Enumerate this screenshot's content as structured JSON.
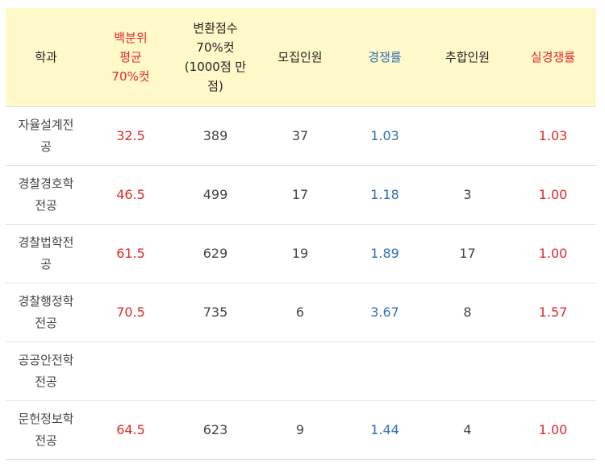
{
  "header": {
    "dept": "학과",
    "percentile": [
      "백분위",
      "평균",
      "70%컷"
    ],
    "converted": [
      "변환점수",
      "70%컷",
      "(1000점 만",
      "점)"
    ],
    "recruit": "모집인원",
    "competition": "경쟁률",
    "additional": "추합인원",
    "real_competition": "실경쟁률"
  },
  "colors": {
    "red": "#e02a2a",
    "blue": "#2f6fb8",
    "header_bg": "#fff8c8"
  },
  "rows": [
    {
      "dept": [
        "자율설계전",
        "공"
      ],
      "percentile": "32.5",
      "converted": "389",
      "recruit": "37",
      "competition": "1.03",
      "additional": "",
      "real": "1.03"
    },
    {
      "dept": [
        "경찰경호학",
        "전공"
      ],
      "percentile": "46.5",
      "converted": "499",
      "recruit": "17",
      "competition": "1.18",
      "additional": "3",
      "real": "1.00"
    },
    {
      "dept": [
        "경찰법학전",
        "공"
      ],
      "percentile": "61.5",
      "converted": "629",
      "recruit": "19",
      "competition": "1.89",
      "additional": "17",
      "real": "1.00"
    },
    {
      "dept": [
        "경찰행정학",
        "전공"
      ],
      "percentile": "70.5",
      "converted": "735",
      "recruit": "6",
      "competition": "3.67",
      "additional": "8",
      "real": "1.57"
    },
    {
      "dept": [
        "공공안전학",
        "전공"
      ],
      "percentile": "",
      "converted": "",
      "recruit": "",
      "competition": "",
      "additional": "",
      "real": ""
    },
    {
      "dept": [
        "문헌정보학",
        "전공"
      ],
      "percentile": "64.5",
      "converted": "623",
      "recruit": "9",
      "competition": "1.44",
      "additional": "4",
      "real": "1.00"
    }
  ]
}
